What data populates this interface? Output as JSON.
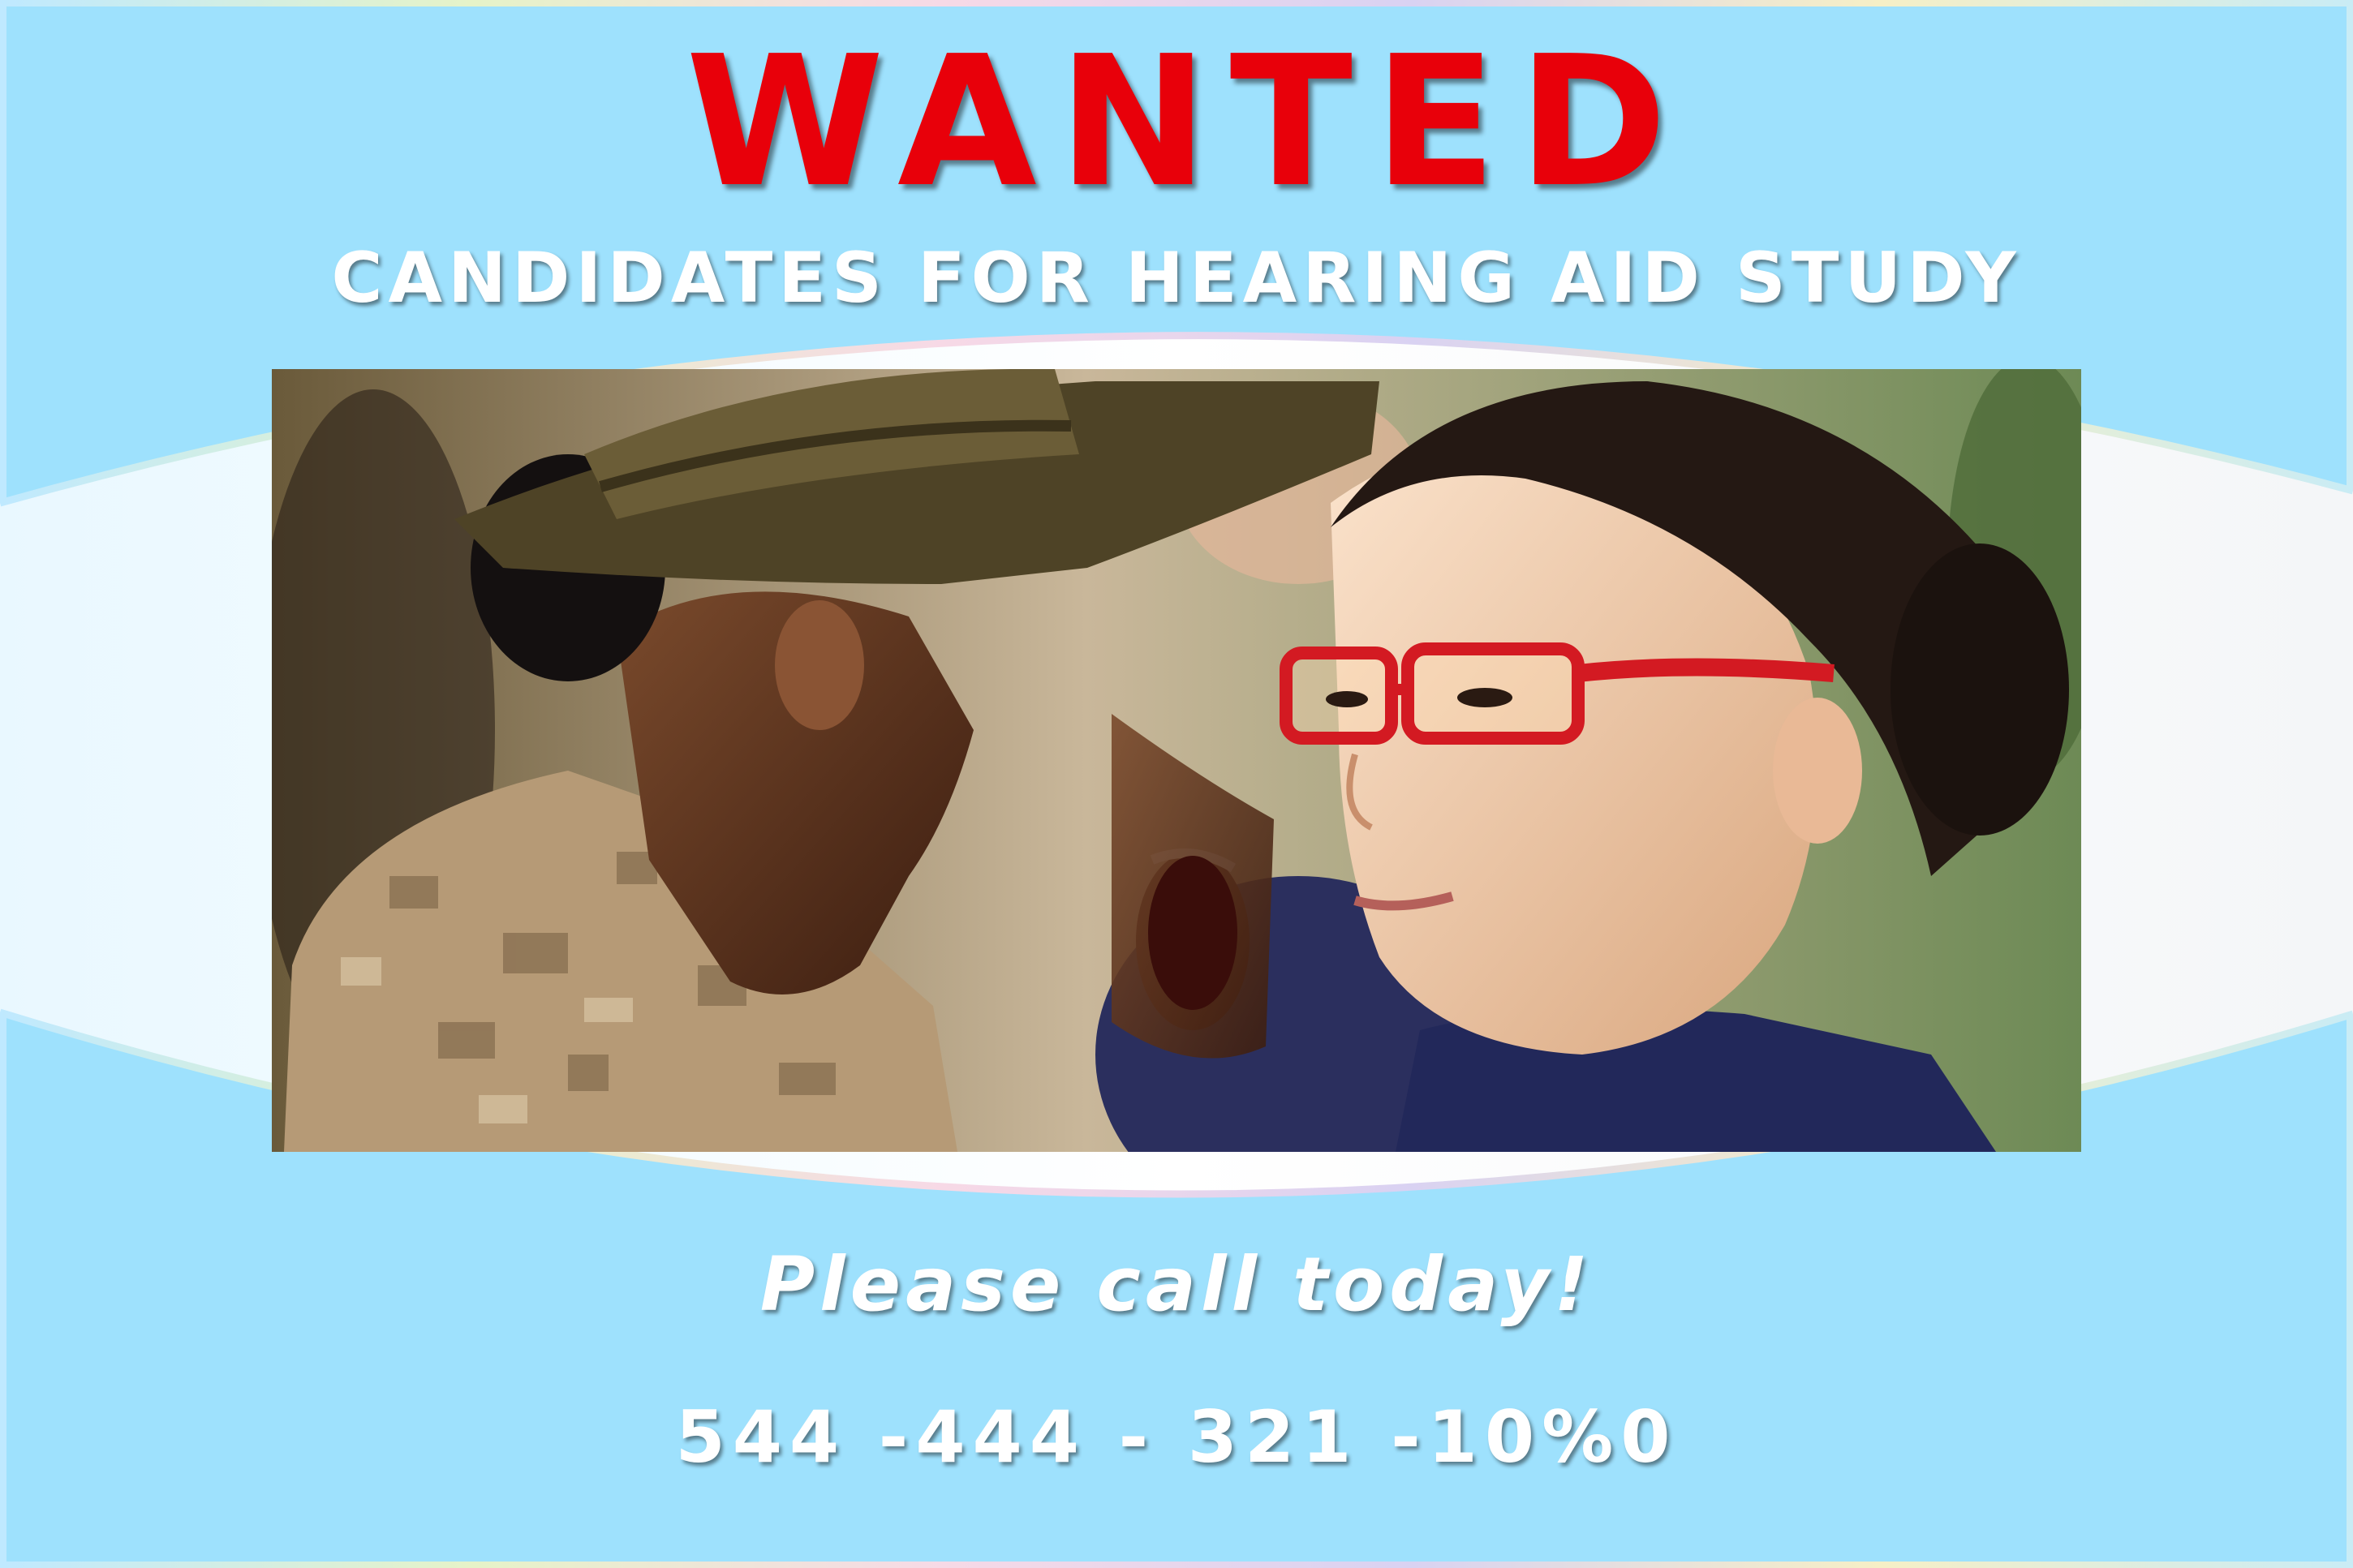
{
  "poster": {
    "headline": "WANTED",
    "subheadline": "CANDIDATES FOR HEARING AID STUDY",
    "call_to_action": "Please call today!",
    "phone_number": "544 -444 - 321 -10%0"
  },
  "photo": {
    "subject": "photograph"
  },
  "colors": {
    "background": "#9ee1fd",
    "band": "#f2fbff",
    "headline": "#e8000a",
    "text": "#ffffff"
  }
}
